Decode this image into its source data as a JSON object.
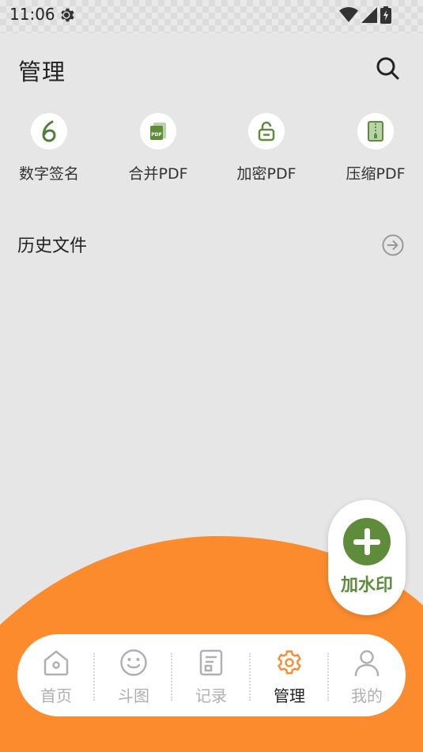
{
  "status_bar": {
    "time": "11:06"
  },
  "header": {
    "title": "管理"
  },
  "tools": [
    {
      "label": "数字签名",
      "icon": "signature-icon"
    },
    {
      "label": "合并PDF",
      "icon": "merge-pdf-icon"
    },
    {
      "label": "加密PDF",
      "icon": "lock-icon"
    },
    {
      "label": "压缩PDF",
      "icon": "zip-file-icon"
    }
  ],
  "history": {
    "label": "历史文件"
  },
  "fab": {
    "label": "加水印"
  },
  "tabbar": {
    "items": [
      {
        "label": "首页",
        "icon": "home-icon"
      },
      {
        "label": "斗图",
        "icon": "smiley-icon"
      },
      {
        "label": "记录",
        "icon": "document-icon"
      },
      {
        "label": "管理",
        "icon": "gear-icon",
        "active": true
      },
      {
        "label": "我的",
        "icon": "user-icon"
      }
    ]
  },
  "colors": {
    "accent_orange": "#fb8b2d",
    "brand_green": "#5e8c3a",
    "background": "#e6e6e6"
  }
}
